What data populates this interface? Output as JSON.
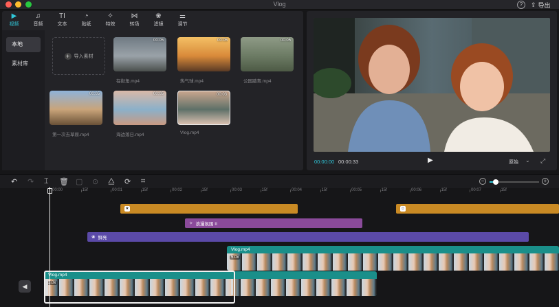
{
  "window": {
    "title": "Vlog",
    "help_icon": "?",
    "export_label": "导出"
  },
  "media": {
    "tabs": [
      {
        "label": "视频",
        "icon": "video-icon",
        "glyph": "▶",
        "active": true
      },
      {
        "label": "音频",
        "icon": "audio-icon",
        "glyph": "♫",
        "active": false
      },
      {
        "label": "文本",
        "icon": "text-icon",
        "glyph": "TI",
        "active": false
      },
      {
        "label": "贴纸",
        "icon": "sticker-icon",
        "glyph": "◔",
        "active": false
      },
      {
        "label": "特效",
        "icon": "effects-icon",
        "glyph": "✧",
        "active": false
      },
      {
        "label": "转场",
        "icon": "transition-icon",
        "glyph": "⋈",
        "active": false
      },
      {
        "label": "滤镜",
        "icon": "filter-icon",
        "glyph": "❀",
        "active": false
      },
      {
        "label": "调节",
        "icon": "adjust-icon",
        "glyph": "⚌",
        "active": false
      }
    ],
    "sidebar": [
      {
        "label": "本地",
        "active": true
      },
      {
        "label": "素材库",
        "active": false
      }
    ],
    "import_label": "导入素材",
    "clips": [
      {
        "name": "在街角.mp4",
        "duration": "00:05",
        "colors": "#6f7a83,#9aa2a8,#4a4f4d"
      },
      {
        "name": "热气球.mp4",
        "duration": "00:05",
        "colors": "#f3c065,#d98a3a,#5a3a25"
      },
      {
        "name": "公园踏青.mp4",
        "duration": "00:05",
        "colors": "#8e9a86,#6c7b64,#4d5a45"
      },
      {
        "name": "第一次去草原.mp4",
        "duration": "00:05",
        "colors": "#8fb3d9,#c9a47a,#6a5137"
      },
      {
        "name": "海边落日.mp4",
        "duration": "00:05",
        "colors": "#d9b9a8,#8bb0c9,#c99a82"
      },
      {
        "name": "Vlog.mp4",
        "duration": "00:03",
        "colors": "#c8a58e,#5e7068,#d9c0b0"
      }
    ]
  },
  "preview": {
    "current_time": "00:00:00",
    "total_time": "00:00:33",
    "ratio_label": "原始"
  },
  "timeline": {
    "ruler": [
      "00:00",
      "15f",
      "00:01",
      "15f",
      "00:02",
      "15f",
      "00:03",
      "15f",
      "00:04",
      "15f",
      "00:05",
      "15f",
      "00:06",
      "15f",
      "00:07",
      "15f"
    ],
    "zoom_level": 0.12,
    "tracks": {
      "sticker1_icon": "★",
      "sticker2_icon": "☺",
      "effect_label": "浪漫氛围 II",
      "filter_label": "鲜亮",
      "main_clip": {
        "name": "Vlog.mp4",
        "speed": "5.0x"
      },
      "overlay_clip": {
        "name": "Vlog.mp4",
        "speed": "3.0x"
      }
    }
  }
}
